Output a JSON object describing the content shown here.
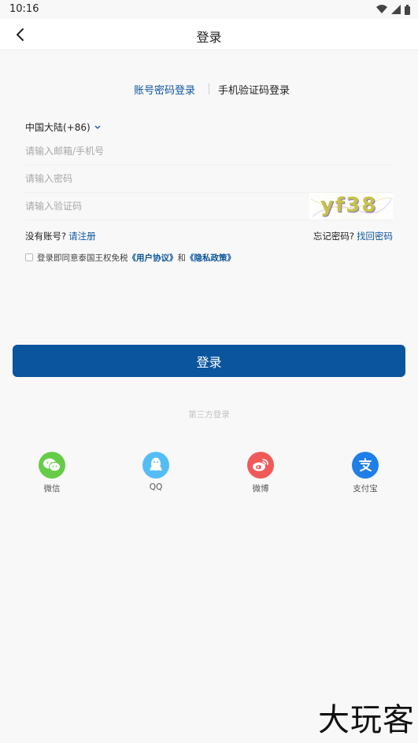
{
  "status_bar": {
    "time": "10:16"
  },
  "header": {
    "title": "登录"
  },
  "tabs": {
    "account_label": "账号密码登录",
    "sms_label": "手机验证码登录"
  },
  "region": {
    "label": "中国大陆(+86)"
  },
  "form": {
    "email_placeholder": "请输入邮箱/手机号",
    "password_placeholder": "请输入密码",
    "captcha_placeholder": "请输入验证码",
    "captcha_text": "yf38"
  },
  "links": {
    "no_account": "没有账号?",
    "register": "请注册",
    "forgot": "忘记密码?",
    "recover": "找回密码"
  },
  "agreement": {
    "prefix": "登录即同意泰国王权免税",
    "user_agreement": "《用户协议》",
    "and": "和",
    "privacy_policy": "《隐私政策》"
  },
  "login_button": {
    "label": "登录"
  },
  "third_party": {
    "title": "第三方登录",
    "items": [
      {
        "label": "微信",
        "icon": "wechat-icon",
        "color": "#66cc48"
      },
      {
        "label": "QQ",
        "icon": "qq-icon",
        "color": "#55bdf5"
      },
      {
        "label": "微博",
        "icon": "weibo-icon",
        "color": "#ef5a59"
      },
      {
        "label": "支付宝",
        "icon": "alipay-icon",
        "color": "#1f7ee8"
      }
    ]
  },
  "colors": {
    "accent": "#0b559e"
  },
  "watermark": {
    "text": "大玩客"
  }
}
